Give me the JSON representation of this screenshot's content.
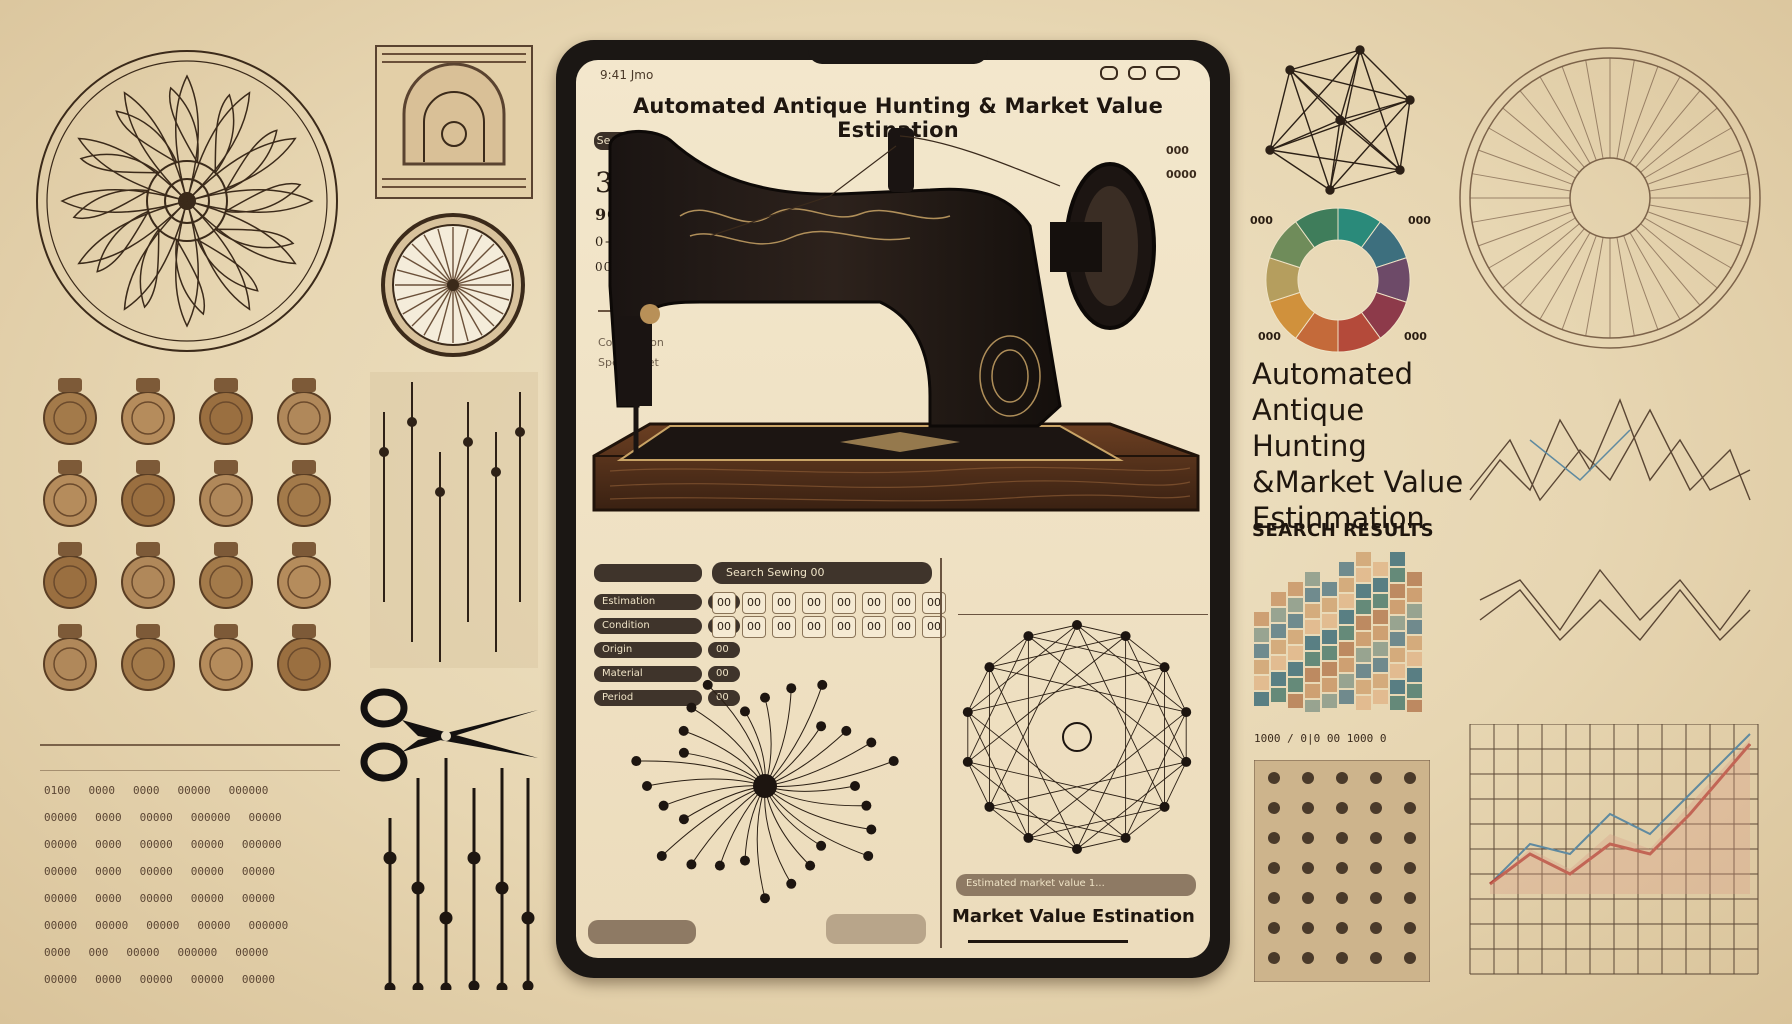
{
  "tablet": {
    "status_left": "9:41  Jmo",
    "title": "Automated Antique Hunting & Market Value Estination",
    "top_pill": "Search 0%",
    "stats": {
      "big_number": "32.2",
      "line2": "9089",
      "line3": "0+0.6:10",
      "line4": "00000 10"
    },
    "side_labels": [
      "000",
      "0000"
    ],
    "left_caption_1": "Comparison",
    "left_caption_2": "Spec sheet",
    "filters": [
      {
        "label": "Estimation"
      },
      {
        "label": "Condition"
      },
      {
        "label": "Origin"
      },
      {
        "label": "Material"
      },
      {
        "label": "Period"
      }
    ],
    "filter_values": [
      "00",
      "00",
      "00",
      "00",
      "00"
    ],
    "search_box": "Search Sewing 00",
    "grid_row1": [
      "00",
      "00",
      "00",
      "00",
      "00",
      "00",
      "00",
      "00"
    ],
    "grid_row2": [
      "00",
      "00",
      "00",
      "00",
      "00",
      "00",
      "00",
      "00"
    ],
    "market_bar": "Estimated market value 1...",
    "market_label": "Market Value Estination"
  },
  "right_panel": {
    "headline_lines": [
      "Automated",
      "Antique Hunting",
      "&Market Value",
      "Estinmation"
    ],
    "search_results": "SEARCH RESULTS",
    "donut_labels": [
      "000",
      "000",
      "000",
      "000"
    ],
    "caption_row": "1000 / 0|0 00 1000 0"
  },
  "donut": {
    "colors": [
      "#2a8a7a",
      "#3d6f7e",
      "#6d4a68",
      "#8d3a4a",
      "#b44a3a",
      "#c46a3a",
      "#d0913c",
      "#b59e5e",
      "#6f8c5a",
      "#3f7d5b"
    ]
  },
  "left_table": {
    "rows": [
      [
        "0100",
        "0000",
        "0000",
        "00000",
        "000000"
      ],
      [
        "00000",
        "0000",
        "00000",
        "000000",
        "00000"
      ],
      [
        "00000",
        "0000",
        "00000",
        "00000",
        "000000"
      ],
      [
        "00000",
        "0000",
        "00000",
        "00000",
        "00000"
      ],
      [
        "00000",
        "0000",
        "00000",
        "00000",
        "00000"
      ],
      [
        "00000",
        "00000",
        "00000",
        "00000",
        "000000"
      ],
      [
        "0000",
        "000",
        "00000",
        "000000",
        "00000"
      ],
      [
        "00000",
        "0000",
        "00000",
        "00000",
        "00000"
      ]
    ]
  },
  "heat_colors": [
    "#3f6f7a",
    "#4d7b6f",
    "#b57b52",
    "#c99566",
    "#8a9a8a",
    "#5a7d86",
    "#d0a372",
    "#e0b68a"
  ]
}
